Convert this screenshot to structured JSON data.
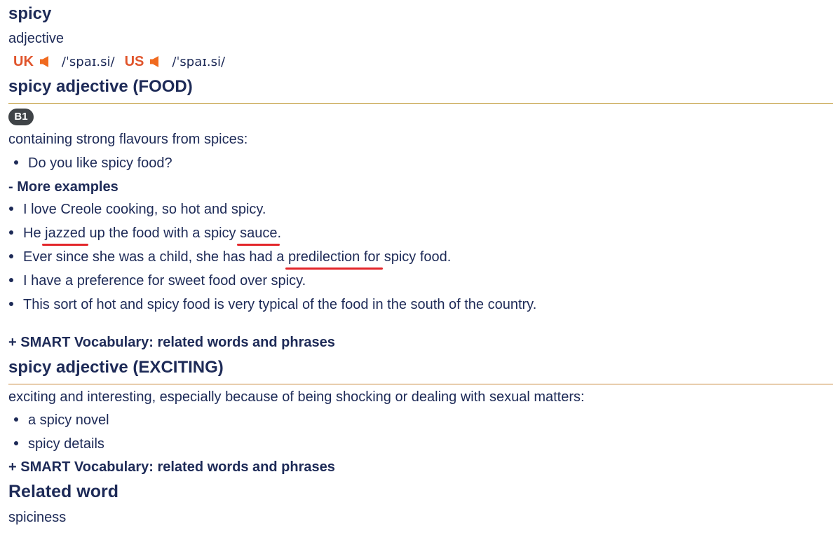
{
  "entry": {
    "headword": "spicy",
    "part_of_speech": "adjective",
    "pronunciations": [
      {
        "region": "UK",
        "ipa": "/ˈspaɪ.si/"
      },
      {
        "region": "US",
        "ipa": "/ˈspaɪ.si/"
      }
    ]
  },
  "senses": [
    {
      "title": "spicy adjective (FOOD)",
      "level": "B1",
      "definition": "containing strong flavours from spices:",
      "examples": [
        "Do you like spicy food?"
      ],
      "more_examples_label": "- More examples",
      "more_examples": {
        "e1": "I love Creole cooking, so hot and spicy.",
        "e2": {
          "a": "He ",
          "b": "jazzed",
          "c": " up the food with a spicy ",
          "d": "sauce",
          "e": "."
        },
        "e3": {
          "a": "Ever since she was a child, she has had a ",
          "b": "predilection for",
          "c": " spicy food."
        },
        "e4": "I have a preference for sweet food over spicy.",
        "e5": "This sort of hot and spicy food is very typical of the food in the south of the country."
      },
      "smart_vocab": "+ SMART Vocabulary: related words and phrases"
    },
    {
      "title": "spicy adjective (EXCITING)",
      "definition": "exciting and interesting, especially because of being shocking or dealing with sexual matters:",
      "examples": [
        "a spicy novel",
        "spicy details"
      ],
      "smart_vocab": "+ SMART Vocabulary: related words and phrases"
    }
  ],
  "related": {
    "heading": "Related word",
    "words": [
      "spiciness"
    ]
  },
  "colors": {
    "text": "#1d2a57",
    "region": "#e0542b",
    "speaker": "#f06a1f",
    "annotation": "#e3262a"
  },
  "icons": {
    "speaker": "speaker-icon"
  }
}
